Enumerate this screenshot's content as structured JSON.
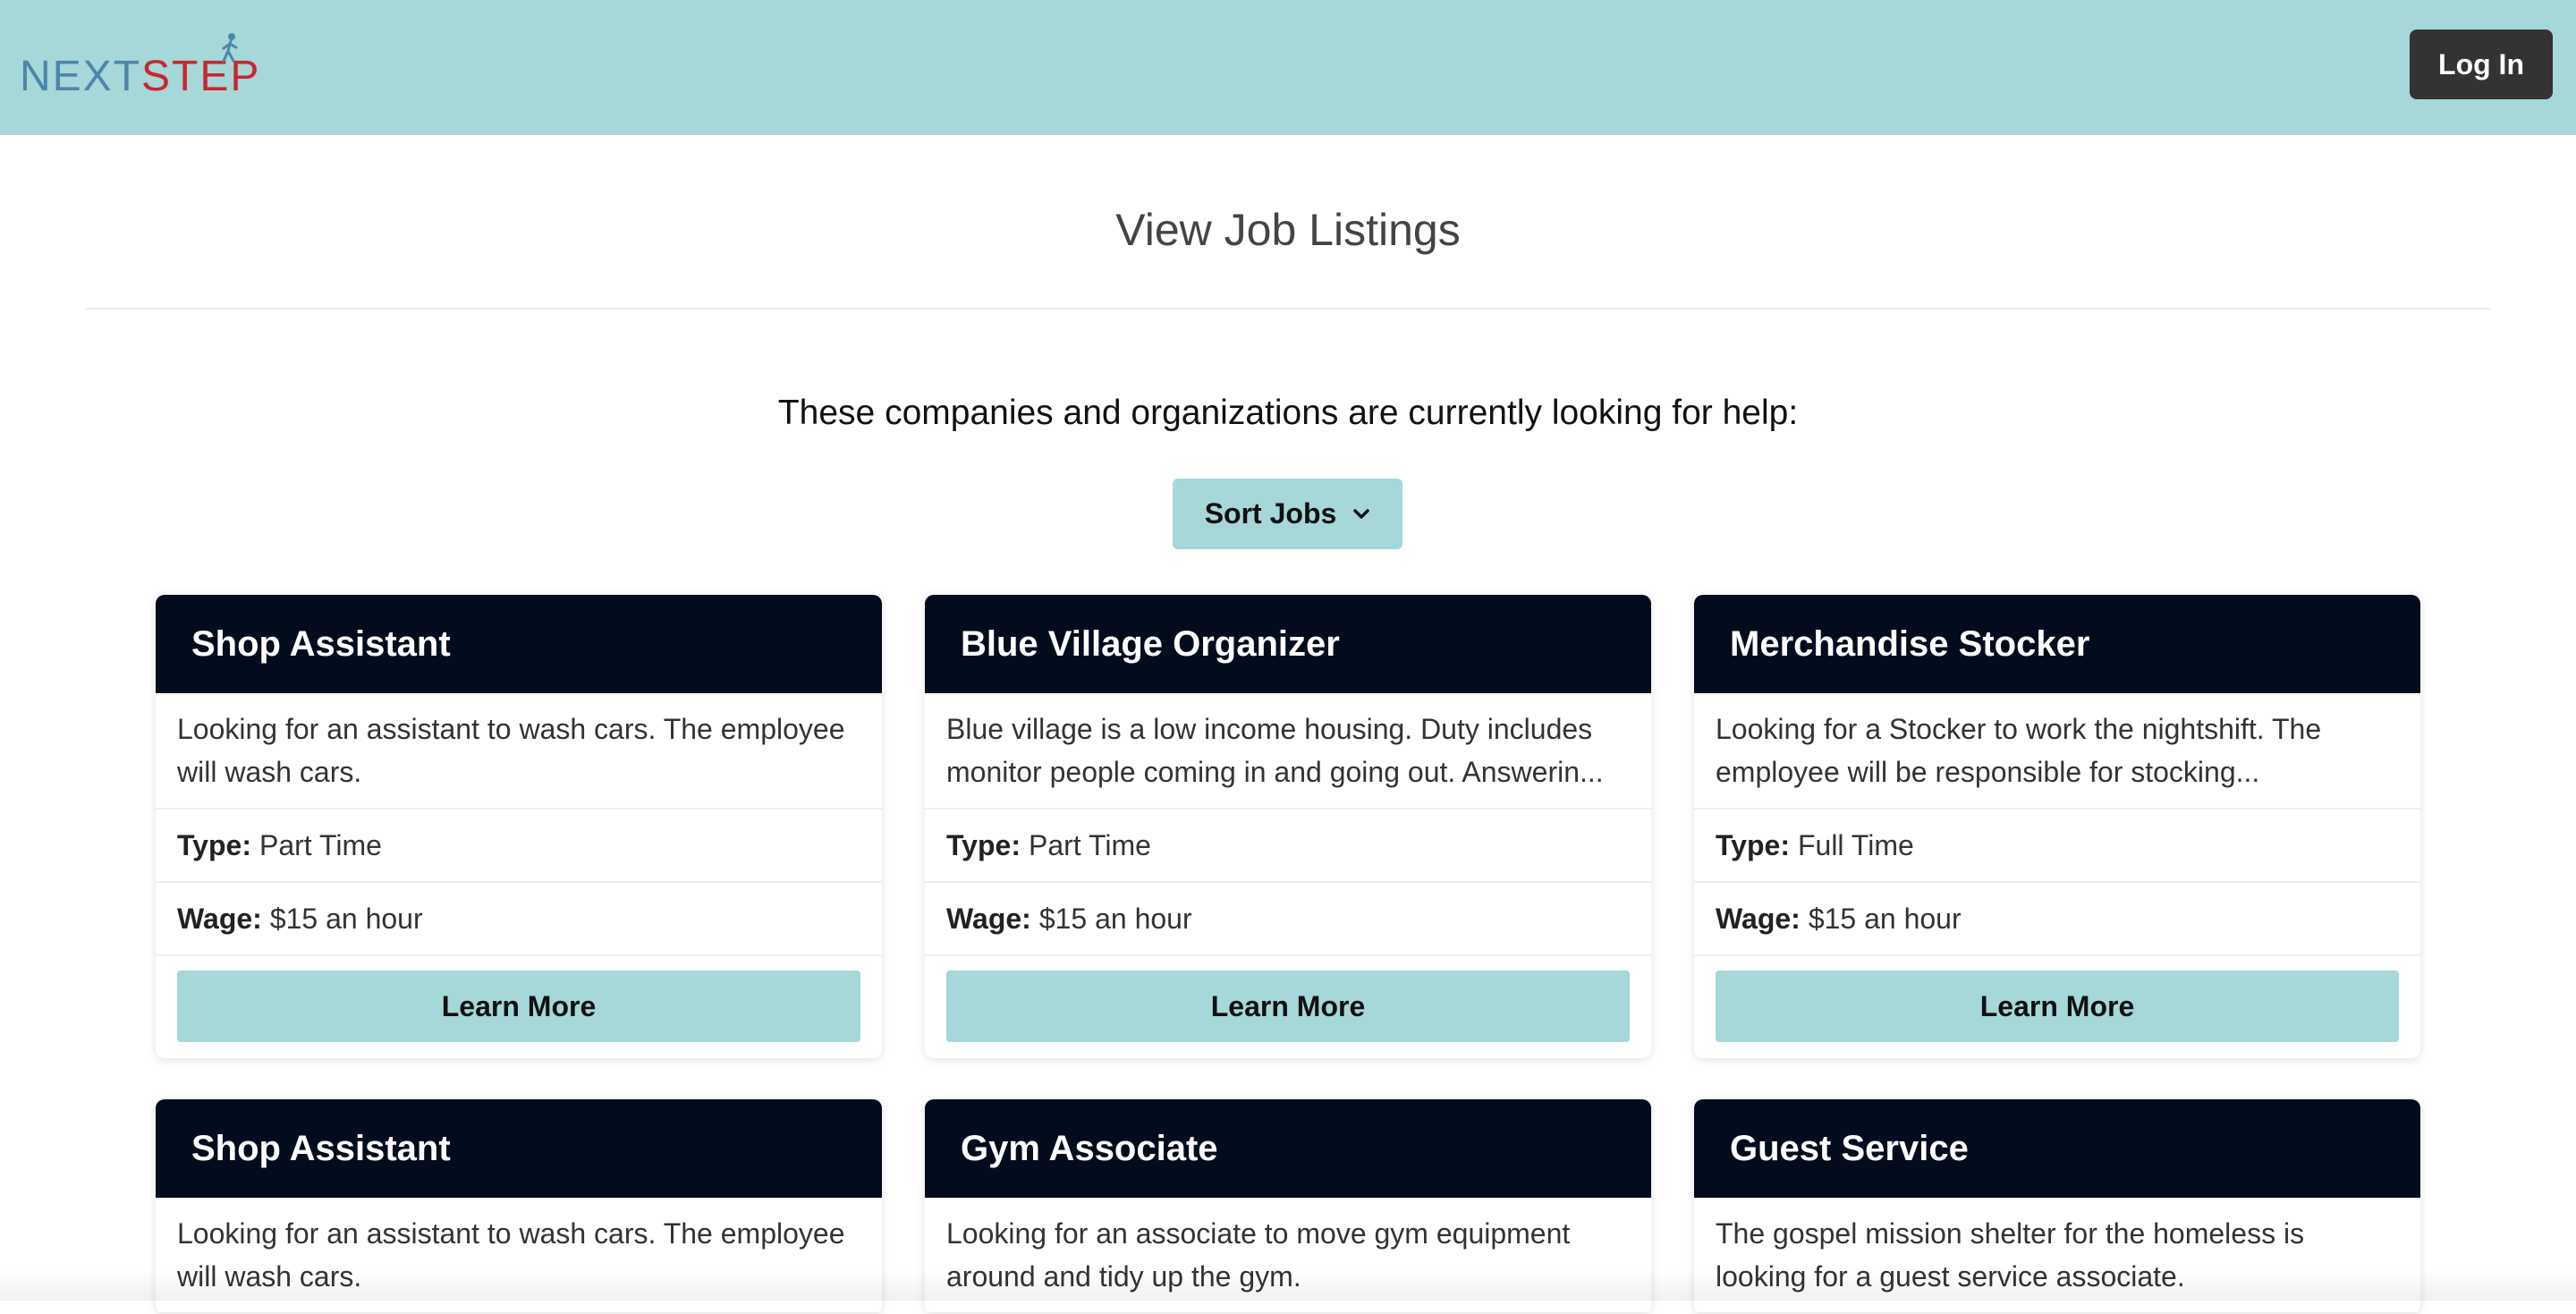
{
  "header": {
    "logo_next": "NEXT",
    "logo_step": "STEP",
    "login_label": "Log In",
    "colors": {
      "navbar": "#a6d7d9",
      "logo_next": "#4d86a8",
      "logo_step": "#c8262f",
      "login_bg": "#333333"
    }
  },
  "main": {
    "title": "View Job Listings",
    "subtitle": "These companies and organizations are currently looking for help:",
    "sort_label": "Sort Jobs",
    "colors": {
      "card_header": "#020c1c",
      "accent": "#a6d7d9"
    }
  },
  "jobs": [
    {
      "title": "Shop Assistant",
      "description": "Looking for an assistant to wash cars. The employee will wash cars.",
      "type_label": "Type:",
      "type": "Part Time",
      "wage_label": "Wage:",
      "wage": "$15 an hour",
      "button": "Learn More"
    },
    {
      "title": "Blue Village Organizer",
      "description": "Blue village is a low income housing. Duty includes monitor people coming in and going out. Answerin...",
      "type_label": "Type:",
      "type": "Part Time",
      "wage_label": "Wage:",
      "wage": "$15 an hour",
      "button": "Learn More"
    },
    {
      "title": "Merchandise Stocker",
      "description": "Looking for a Stocker to work the nightshift. The employee will be responsible for stocking...",
      "type_label": "Type:",
      "type": "Full Time",
      "wage_label": "Wage:",
      "wage": "$15 an hour",
      "button": "Learn More"
    },
    {
      "title": "Shop Assistant",
      "description": "Looking for an assistant to wash cars. The employee will wash cars."
    },
    {
      "title": "Gym Associate",
      "description": "Looking for an associate to move gym equipment around and tidy up the gym."
    },
    {
      "title": "Guest Service",
      "description": "The gospel mission shelter for the homeless is looking for a guest service associate."
    }
  ]
}
